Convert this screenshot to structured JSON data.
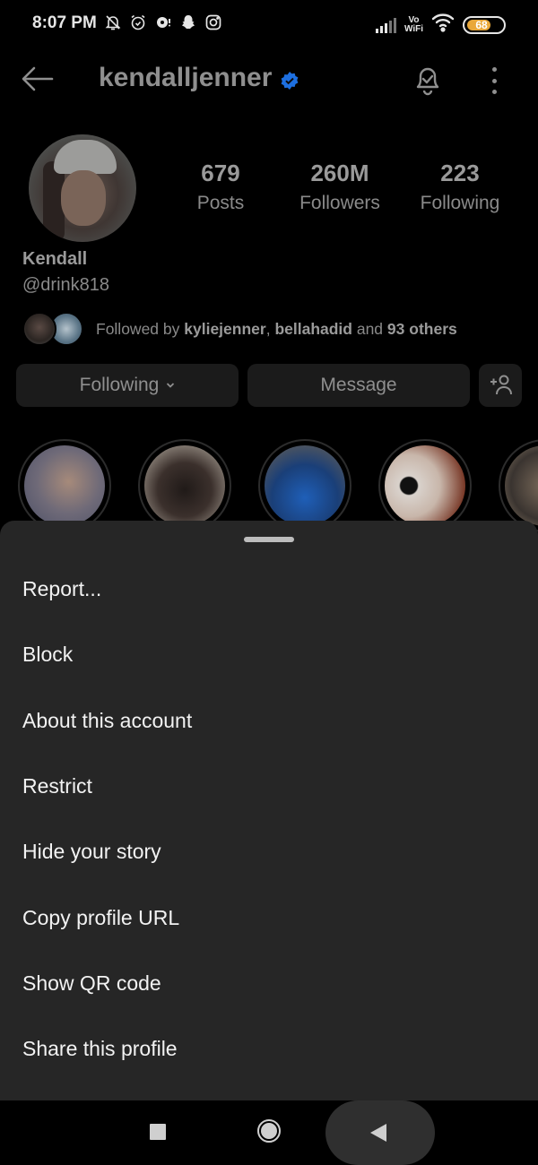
{
  "status_bar": {
    "time": "8:07 PM",
    "left_icons": [
      "notifications-off-icon",
      "alarm-icon",
      "messaging-icon",
      "snapchat-icon",
      "instagram-icon"
    ],
    "network_label_top": "Vo",
    "network_label_bottom": "WiFi",
    "battery_level": "68",
    "battery_percent": 68,
    "battery_color": "#e9a83a"
  },
  "header": {
    "username": "kendalljenner",
    "verified": true,
    "verified_color": "#1d6fe0"
  },
  "profile": {
    "display_name": "Kendall",
    "handle": "@drink818",
    "stats": [
      {
        "value": "679",
        "label": "Posts"
      },
      {
        "value": "260M",
        "label": "Followers"
      },
      {
        "value": "223",
        "label": "Following"
      }
    ],
    "followed_by": {
      "prefix": "Followed by ",
      "user1": "kyliejenner",
      "sep": ", ",
      "user2": "bellahadid",
      "mid": " and ",
      "others": "93 others"
    }
  },
  "actions": {
    "following_label": "Following",
    "message_label": "Message"
  },
  "highlights_count_visible": 5,
  "sheet": {
    "items": [
      {
        "label": "Report..."
      },
      {
        "label": "Block"
      },
      {
        "label": "About this account"
      },
      {
        "label": "Restrict"
      },
      {
        "label": "Hide your story"
      },
      {
        "label": "Copy profile URL"
      },
      {
        "label": "Show QR code"
      },
      {
        "label": "Share this profile"
      }
    ]
  }
}
